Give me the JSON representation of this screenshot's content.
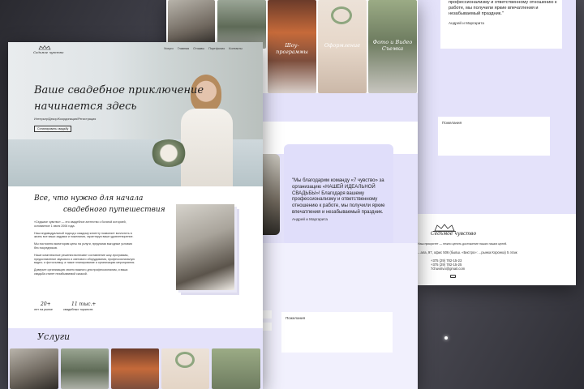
{
  "colors": {
    "lavender": "#e4e2fa",
    "dark": "#1b1b1b"
  },
  "front": {
    "logo_text": "Седьмое чувство",
    "nav": [
      "Услуги",
      "Главная",
      "Отзывы",
      "Портфолио",
      "Контакты"
    ],
    "hero_title_1": "Ваше свадебное приключение",
    "hero_title_2": "начинается здесь",
    "hero_sub": "Интерьер/Декор/Координация/Регистрация",
    "hero_button": "Спланировать свадьбу",
    "about_title_1": "Все, что нужно для начала",
    "about_title_2": "свадебного путешествия",
    "about_p1": "«Седьмое чувство» — это свадебное агентство с богатой историей, основанное 1 июля 2006 года.",
    "about_p2": "Наш индивидуальный подход к каждому клиенту позволяет воплотить в жизнь все ваши задумки и пожелания, гарантируя ваше удовлетворение.",
    "about_p3": "Мы постоянно мониторим цены на услуги, предлагая выгодные условия без посредников.",
    "about_p4": "Наше комплексные решения включают составление шоу-программы, предоставление звукового и светового оборудования, профессиональную видео- и фотосъемку, а также планирование и организацию мероприятия.",
    "about_p5": "Доверьте организацию своего важного дня профессионалам, и ваша свадьба станет незабываемой сказкой.",
    "stat1_value": "20+",
    "stat1_label": "лет на рынке",
    "stat2_value": "11 тыс.+",
    "stat2_label": "свадебных торжеств",
    "services_title": "Услуги"
  },
  "mid": {
    "gallery_labels": [
      "Шоу-программы",
      "Оформление",
      "Фото и Видео Съемка"
    ],
    "testimonial": "\"Мы благодарим команду «7 чувство» за организацию «НАШЕЙ ИДЕАЛЬНОЙ СВАДЬБЫ»! Благодаря вашему профессионализму и ответственному отношению к работе, мы получили яркие впечатления и незабываемый праздник.",
    "testimonial_author": "Андрей и Маргарита",
    "wish_placeholder": "Пожелания"
  },
  "back": {
    "testimonial_tail": "профессионализму и ответственному отношению к работе, мы получили яркие впечатления и незабываемый праздник.\"",
    "testimonial_author": "Андрей и Маргарита",
    "wish_placeholder": "Пожелания",
    "logo_text": "Седьмое чувство",
    "footer_tagline": "Наш приоритет — нежно ценить достижение наших наших целей.",
    "address": "...ала, 97, офис 506 (бывш. «Бистро»: ...рынка Коронка) 5 этаж",
    "phone1": "+375 (29) 782-15-23",
    "phone2": "+375 (29) 782-15-25",
    "email": "7chuvstvo@gmail.com"
  }
}
